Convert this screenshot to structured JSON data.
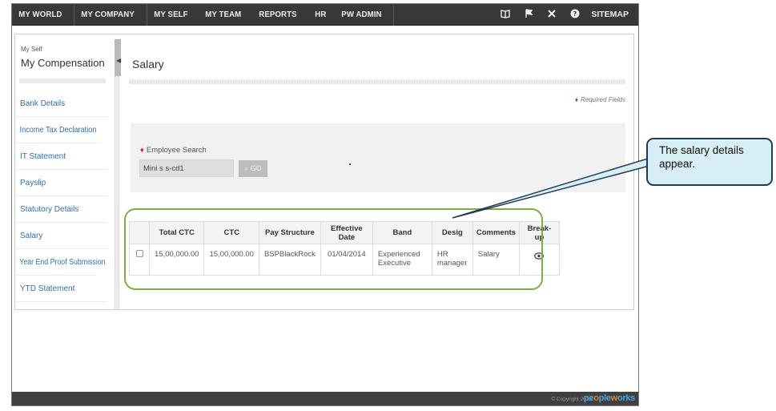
{
  "nav": {
    "items": [
      "MY WORLD",
      "MY COMPANY",
      "MY SELF",
      "MY TEAM",
      "REPORTS",
      "HR",
      "PW ADMIN"
    ],
    "icons": [
      "book-icon",
      "flag-icon",
      "tools-icon",
      "help-icon"
    ],
    "sitemap": "SITEMAP"
  },
  "sidebar": {
    "crumb_small": "My Self",
    "crumb_title": "My Compensation",
    "items": [
      "Bank Details",
      "Income Tax Declaration",
      "IT Statement",
      "Payslip",
      "Statutory Details",
      "Salary",
      "Year End Proof Submission",
      "YTD Statement"
    ]
  },
  "main": {
    "title": "Salary",
    "required_note": "Required Fields",
    "search": {
      "label": "Employee Search",
      "value": "Mini s s-cd1",
      "go_label": "GO"
    }
  },
  "table": {
    "headers": [
      "",
      "Total CTC",
      "CTC",
      "Pay Structure",
      "Effective Date",
      "Band",
      "Desig",
      "Comments",
      "Break-up"
    ],
    "rows": [
      {
        "total_ctc": "15,00,000.00",
        "ctc": "15,00,000.00",
        "pay_structure": "BSPBlackRock",
        "effective_date": "01/04/2014",
        "band_line1": "Experienced",
        "band_line2": "Executive",
        "desig_line1": "HR",
        "desig_line2": "manager",
        "comments": "Salary"
      }
    ]
  },
  "footer": {
    "copyright": "© Copyright 2015",
    "brand_a": "pe",
    "brand_b": "o",
    "brand_c": "ple",
    "brand_d": "w",
    "brand_e": "o",
    "brand_f": "rks"
  },
  "callout": {
    "text": "The salary details appear."
  },
  "colors": {
    "nav_bg": "#383838",
    "link": "#2e6fb5",
    "required": "#d9262e",
    "highlight": "#7fae3f",
    "callout_bg": "#d8eef5",
    "callout_border": "#1f3b5a"
  }
}
